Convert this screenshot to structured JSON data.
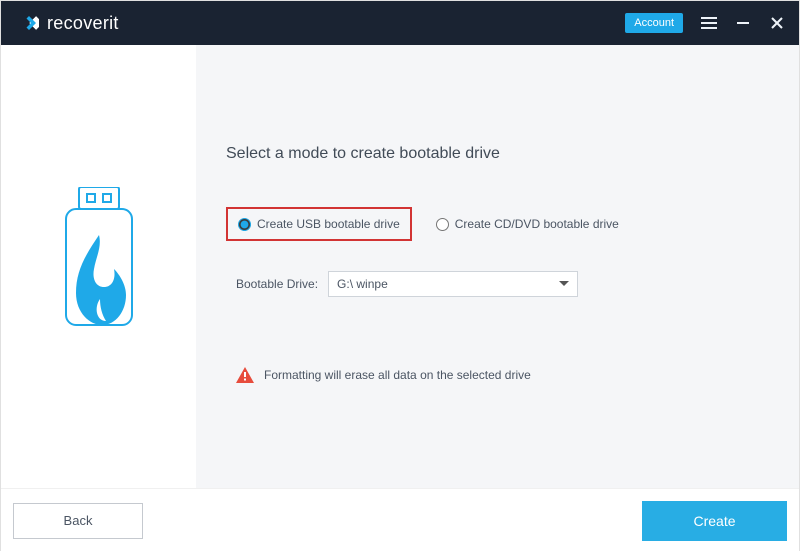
{
  "brand": "recoverit",
  "titlebar": {
    "account_label": "Account"
  },
  "heading": "Select a mode to create bootable drive",
  "radio": {
    "usb_label": "Create USB bootable drive",
    "dvd_label": "Create CD/DVD bootable drive",
    "selected": "usb"
  },
  "drive": {
    "label": "Bootable Drive:",
    "selected": "G:\\ winpe",
    "options": [
      "G:\\ winpe"
    ]
  },
  "warning": "Formatting will erase all data on the selected drive",
  "footer": {
    "back_label": "Back",
    "create_label": "Create"
  },
  "colors": {
    "accent": "#1fa9e8",
    "header_bg": "#1a2332",
    "highlight_border": "#d23434"
  }
}
